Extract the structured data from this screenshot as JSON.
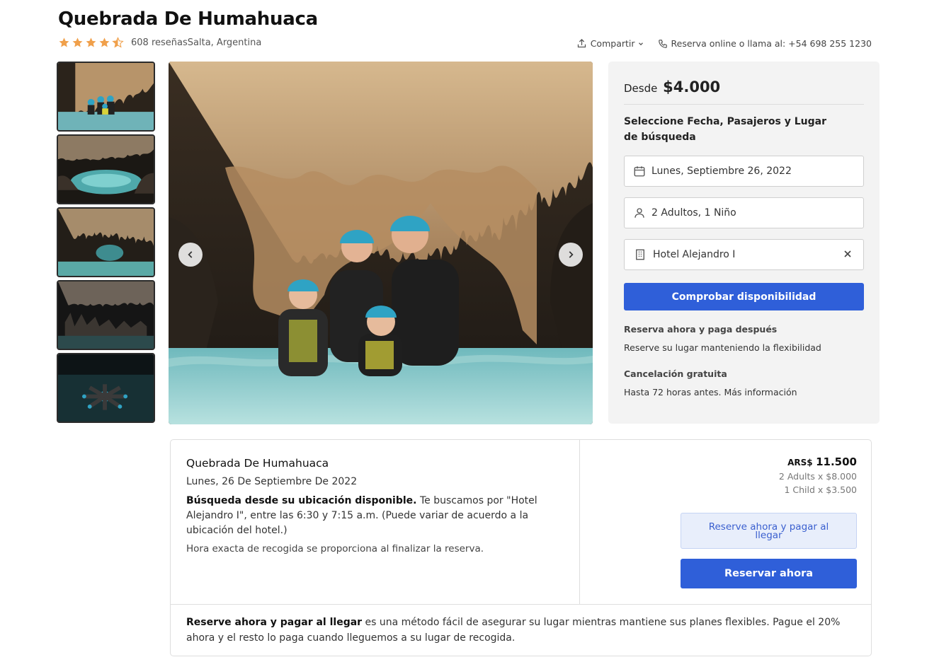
{
  "header": {
    "title": "Quebrada De Humahuaca",
    "rating": 4.5,
    "reviews": "608 reseñas",
    "location": "Salta, Argentina",
    "share_label": "Compartir",
    "call_label": "Reserva online o llama al: +54 698 255 1230"
  },
  "gallery": {
    "thumbnail_count": 5,
    "colors": {
      "cave_dark": "#1d1a16",
      "water": "#7fc3c8",
      "rock": "#c8a47a",
      "helmet": "#2fa3c4"
    }
  },
  "booking": {
    "price_prefix": "Desde",
    "price": "$4.000",
    "select_title": "Seleccione Fecha, Pasajeros y Lugar de búsqueda",
    "date_value": "Lunes, Septiembre 26, 2022",
    "guests_value": "2 Adultos, 1 Niño",
    "hotel_value": "Hotel Alejandro I",
    "check_button": "Comprobar disponibilidad",
    "reserve_later_title": "Reserva ahora y paga después",
    "reserve_later_text": "Reserve su lugar manteniendo la flexibilidad",
    "cancel_title": "Cancelación gratuita",
    "cancel_text": "Hasta 72 horas antes.",
    "cancel_more": "Más información",
    "accent_color": "#2f5fd9"
  },
  "summary": {
    "title": "Quebrada De Humahuaca",
    "date": "Lunes, 26 De Septiembre De 2022",
    "pickup_bold": "Búsqueda desde su ubicación disponible.",
    "pickup_text": "Te buscamos por \"Hotel Alejandro I\", entre las 6:30 y 7:15 a.m. (Puede variar de acuerdo a la ubicación del hotel.)",
    "pickup_note": "Hora exacta de recogida se proporciona al finalizar la reserva.",
    "currency": "ARS$",
    "total": "11.500",
    "line_adults": "2 Adults x $8.000",
    "line_child": "1 Child x $3.500",
    "pay_later_button": "Reserve ahora y pagar al llegar",
    "book_button": "Reservar ahora",
    "footer_bold": "Reserve ahora y pagar al llegar",
    "footer_text": "es una método fácil de asegurar su lugar mientras mantiene sus planes flexibles. Pague el 20% ahora y el resto lo paga cuando lleguemos a su lugar de recogida."
  }
}
